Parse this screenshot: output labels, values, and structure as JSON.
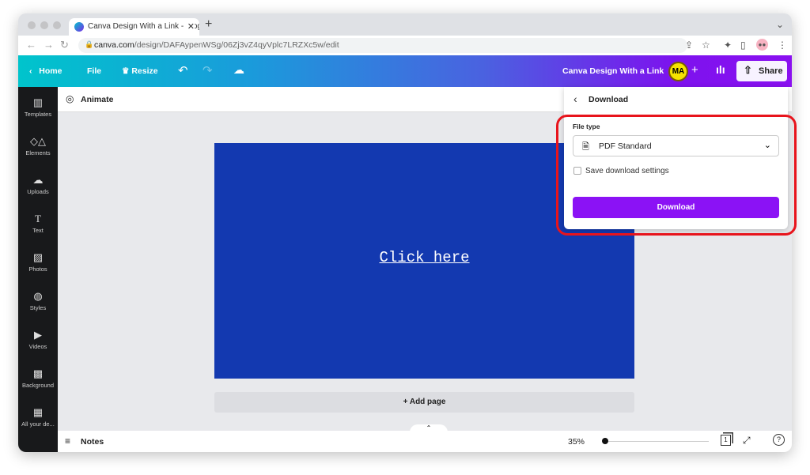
{
  "browser": {
    "tab_title": "Canva Design With a Link - Blog",
    "url_host": "canva.com",
    "url_path": "/design/DAFAypenWSg/06Zj3vZ4qyVplc7LRZXc5w/edit"
  },
  "toolbar": {
    "home": "Home",
    "file": "File",
    "resize": "Resize",
    "design_title": "Canva Design With a Link",
    "avatar": "MA",
    "share": "Share"
  },
  "sidebar": {
    "items": [
      {
        "label": "Templates",
        "icon": "▥"
      },
      {
        "label": "Elements",
        "icon": "◇△"
      },
      {
        "label": "Uploads",
        "icon": "☁"
      },
      {
        "label": "Text",
        "icon": "T"
      },
      {
        "label": "Photos",
        "icon": "▨"
      },
      {
        "label": "Styles",
        "icon": "◍"
      },
      {
        "label": "Videos",
        "icon": "▶"
      },
      {
        "label": "Background",
        "icon": "▩"
      },
      {
        "label": "All your de...",
        "icon": "▦"
      }
    ]
  },
  "objbar": {
    "animate": "Animate"
  },
  "canvas": {
    "link_text": "Click here",
    "add_page": "+ Add page",
    "bg_color": "#1339b0"
  },
  "bottom": {
    "notes": "Notes",
    "zoom": "35%",
    "zoom_value": 35,
    "page_count": "1"
  },
  "download": {
    "title": "Download",
    "file_type_label": "File type",
    "file_type": "PDF Standard",
    "save_settings": "Save download settings",
    "button": "Download",
    "accent": "#8b12f5"
  }
}
